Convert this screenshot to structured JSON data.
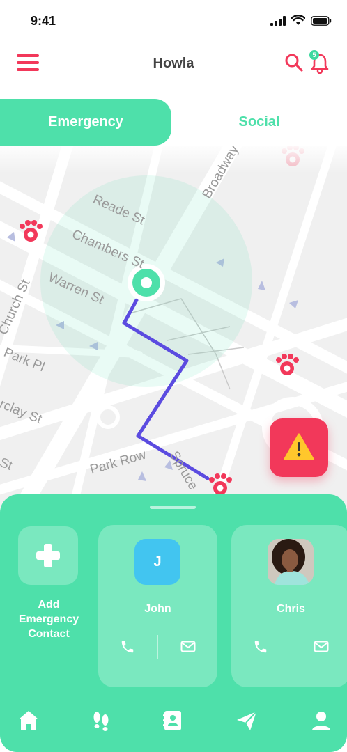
{
  "status": {
    "time": "9:41"
  },
  "header": {
    "title": "Howla",
    "notification_count": "5"
  },
  "tabs": [
    {
      "label": "Emergency",
      "active": true
    },
    {
      "label": "Social",
      "active": false
    }
  ],
  "map": {
    "streets": [
      "Reade St",
      "Chambers St",
      "Warren St",
      "Church St",
      "Park Pl",
      "rclay St",
      "St",
      "Park Row",
      "Spruce",
      "Broadway"
    ]
  },
  "sheet": {
    "add_label": "Add Emergency Contact",
    "contacts": [
      {
        "name": "John",
        "initial": "J",
        "avatar_color": "#42c5f0"
      },
      {
        "name": "Chris",
        "initial": "",
        "avatar_color": "#6b4a3a"
      }
    ]
  },
  "nav": [
    "home-icon",
    "footprints-icon",
    "contacts-book-icon",
    "send-icon",
    "profile-icon"
  ],
  "colors": {
    "accent": "#4ee0aa",
    "alert": "#f2385a",
    "route": "#5b4be0"
  }
}
